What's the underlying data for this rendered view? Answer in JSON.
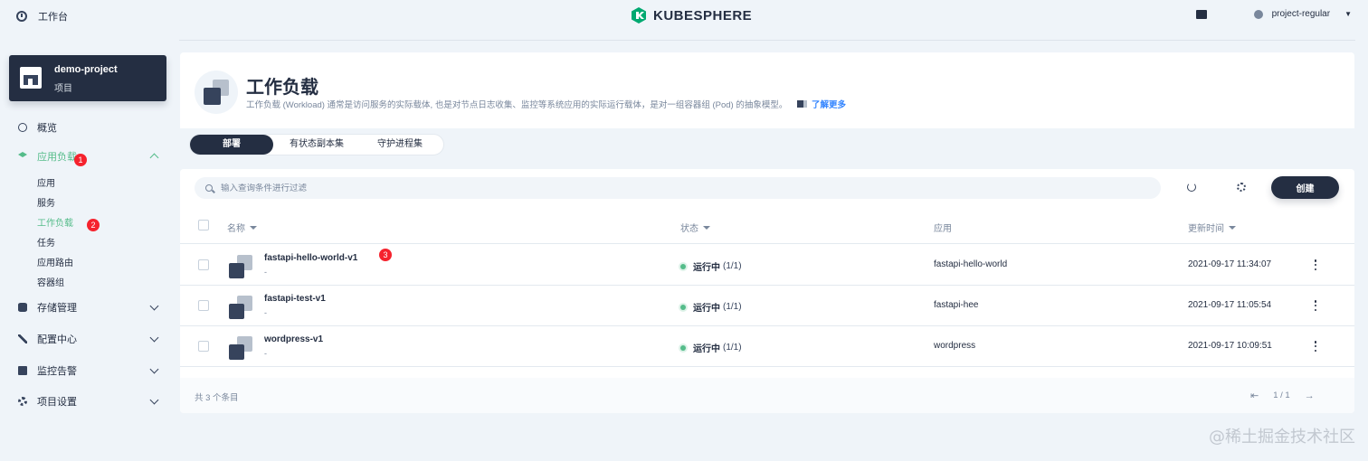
{
  "topbar": {
    "workbench_label": "工作台",
    "logo_text": "KUBESPHERE",
    "user_name": "project-regular"
  },
  "project": {
    "name": "demo-project",
    "type": "项目"
  },
  "nav": {
    "overview": "概览",
    "app_workloads": "应用负载",
    "sub": [
      "应用",
      "服务",
      "工作负载",
      "任务",
      "应用路由",
      "容器组"
    ],
    "storage": "存储管理",
    "config": "配置中心",
    "monitoring": "监控告警",
    "settings": "项目设置"
  },
  "badges": [
    "1",
    "2",
    "3"
  ],
  "header": {
    "title": "工作负载",
    "description": "工作负载 (Workload) 通常是访问服务的实际载体, 也是对节点日志收集、监控等系统应用的实际运行载体，是对一组容器组 (Pod) 的抽象模型。",
    "learn_more": "了解更多"
  },
  "tabs": [
    "部署",
    "有状态副本集",
    "守护进程集"
  ],
  "toolbar": {
    "search_placeholder": "输入查询条件进行过滤",
    "create_label": "创建"
  },
  "table": {
    "columns": [
      "名称",
      "状态",
      "应用",
      "更新时间"
    ],
    "rows": [
      {
        "name": "fastapi-hello-world-v1",
        "desc": "-",
        "status": "运行中",
        "count": "(1/1)",
        "app": "fastapi-hello-world",
        "time": "2021-09-17 11:34:07"
      },
      {
        "name": "fastapi-test-v1",
        "desc": "-",
        "status": "运行中",
        "count": "(1/1)",
        "app": "fastapi-hee",
        "time": "2021-09-17 11:05:54"
      },
      {
        "name": "wordpress-v1",
        "desc": "-",
        "status": "运行中",
        "count": "(1/1)",
        "app": "wordpress",
        "time": "2021-09-17 10:09:51"
      }
    ]
  },
  "footer": {
    "total": "共 3 个条目",
    "page": "1 / 1"
  },
  "watermark": "@稀土掘金技术社区",
  "colors": {
    "accent": "#55bc8a",
    "dark": "#242e42",
    "badge": "#f5222d",
    "link": "#3385ff"
  }
}
